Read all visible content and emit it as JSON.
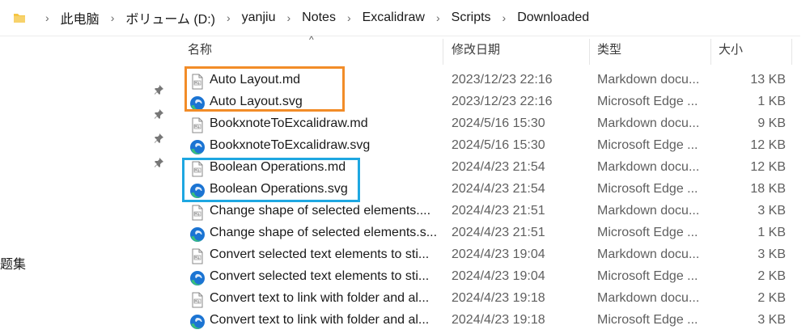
{
  "breadcrumb": [
    "此电脑",
    "ボリューム (D:)",
    "yanjiu",
    "Notes",
    "Excalidraw",
    "Scripts",
    "Downloaded"
  ],
  "nav": {
    "partial_label": "题集"
  },
  "columns": {
    "name": "名称",
    "date": "修改日期",
    "type": "类型",
    "size": "大小"
  },
  "files": [
    {
      "name": "Auto Layout.md",
      "date": "2023/12/23 22:16",
      "type": "Markdown docu...",
      "size": "13 KB",
      "icon": "markdown-file-icon"
    },
    {
      "name": "Auto Layout.svg",
      "date": "2023/12/23 22:16",
      "type": "Microsoft Edge ...",
      "size": "1 KB",
      "icon": "edge-icon"
    },
    {
      "name": "BookxnoteToExcalidraw.md",
      "date": "2024/5/16 15:30",
      "type": "Markdown docu...",
      "size": "9 KB",
      "icon": "markdown-file-icon"
    },
    {
      "name": "BookxnoteToExcalidraw.svg",
      "date": "2024/5/16 15:30",
      "type": "Microsoft Edge ...",
      "size": "12 KB",
      "icon": "edge-icon"
    },
    {
      "name": "Boolean Operations.md",
      "date": "2024/4/23 21:54",
      "type": "Markdown docu...",
      "size": "12 KB",
      "icon": "markdown-file-icon"
    },
    {
      "name": "Boolean Operations.svg",
      "date": "2024/4/23 21:54",
      "type": "Microsoft Edge ...",
      "size": "18 KB",
      "icon": "edge-icon"
    },
    {
      "name": "Change shape of selected elements....",
      "date": "2024/4/23 21:51",
      "type": "Markdown docu...",
      "size": "3 KB",
      "icon": "markdown-file-icon"
    },
    {
      "name": "Change shape of selected elements.s...",
      "date": "2024/4/23 21:51",
      "type": "Microsoft Edge ...",
      "size": "1 KB",
      "icon": "edge-icon"
    },
    {
      "name": "Convert selected text elements to sti...",
      "date": "2024/4/23 19:04",
      "type": "Markdown docu...",
      "size": "3 KB",
      "icon": "markdown-file-icon"
    },
    {
      "name": "Convert selected text elements to sti...",
      "date": "2024/4/23 19:04",
      "type": "Microsoft Edge ...",
      "size": "2 KB",
      "icon": "edge-icon"
    },
    {
      "name": "Convert text to link with folder and al...",
      "date": "2024/4/23 19:18",
      "type": "Markdown docu...",
      "size": "2 KB",
      "icon": "markdown-file-icon"
    },
    {
      "name": "Convert text to link with folder and al...",
      "date": "2024/4/23 19:18",
      "type": "Microsoft Edge ...",
      "size": "3 KB",
      "icon": "edge-icon"
    }
  ],
  "colors": {
    "highlight_orange": "#f28c28",
    "highlight_blue": "#1ea7e1",
    "folder": "#f5c542",
    "edge_blue": "#1b74d3",
    "edge_green": "#38c07a"
  }
}
